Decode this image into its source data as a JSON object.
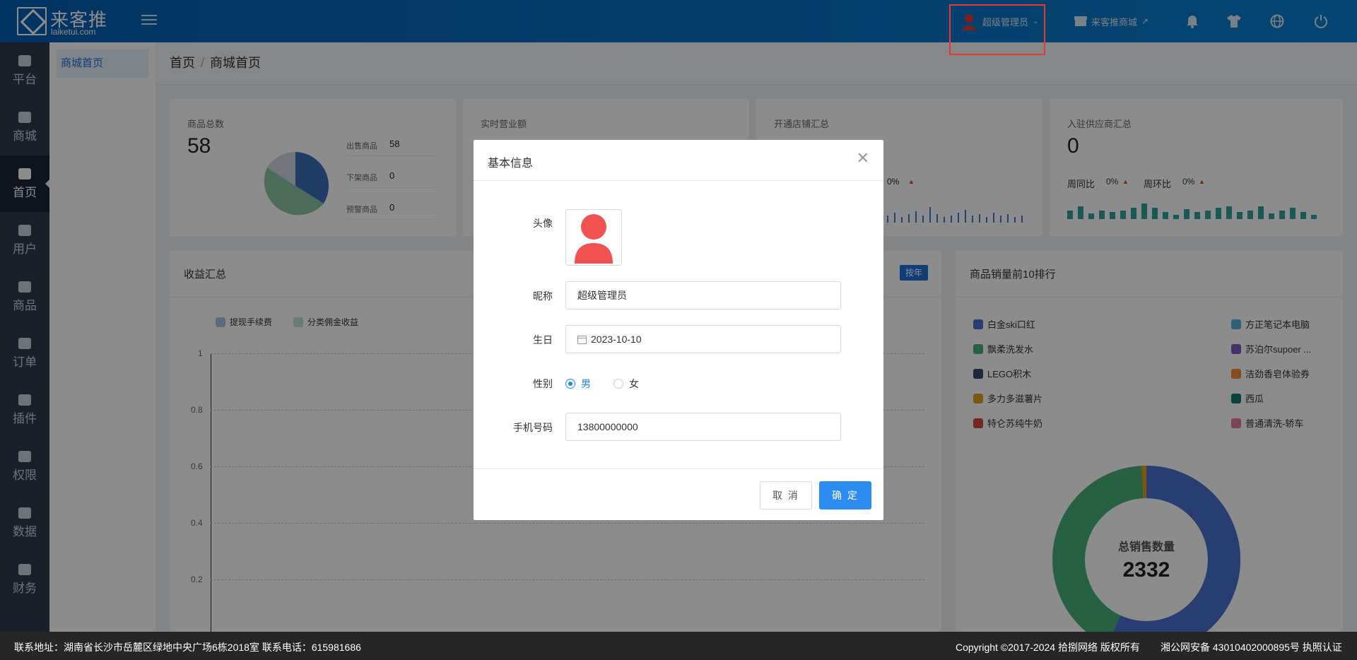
{
  "header": {
    "logo_cn": "来客推",
    "logo_en": "laiketui.com",
    "user_name": "超级管理员",
    "store_link": "来客推商城"
  },
  "sidebar": {
    "items": [
      {
        "label": "平台",
        "icon": "platform-icon"
      },
      {
        "label": "商城",
        "icon": "mall-icon"
      },
      {
        "label": "首页",
        "icon": "home-icon"
      },
      {
        "label": "用户",
        "icon": "user-icon"
      },
      {
        "label": "商品",
        "icon": "goods-icon"
      },
      {
        "label": "订单",
        "icon": "order-icon"
      },
      {
        "label": "插件",
        "icon": "plugin-icon"
      },
      {
        "label": "权限",
        "icon": "shield-icon"
      },
      {
        "label": "数据",
        "icon": "pie-icon"
      },
      {
        "label": "财务",
        "icon": "wallet-icon"
      }
    ]
  },
  "subnav": {
    "item": "商城首页"
  },
  "breadcrumb": {
    "home": "首页",
    "current": "商城首页"
  },
  "cards": {
    "goods": {
      "title": "商品总数",
      "total": "58",
      "rows": [
        {
          "label": "出售商品",
          "value": "58"
        },
        {
          "label": "下架商品",
          "value": "0"
        },
        {
          "label": "预警商品",
          "value": "0"
        }
      ]
    },
    "sales": {
      "title": "实时营业额"
    },
    "stores": {
      "title": "开通店铺汇总",
      "pct": "0%"
    },
    "suppliers": {
      "title": "入驻供应商汇总",
      "total": "0",
      "week_label": "周同比",
      "week_val": "0%",
      "ring_label": "周环比",
      "ring_val": "0%"
    }
  },
  "revenue": {
    "title": "收益汇总",
    "by_year": "按年",
    "legend": [
      "提现手续费",
      "分类佣金收益"
    ],
    "ticks": [
      "1",
      "0.8",
      "0.6",
      "0.4",
      "0.2"
    ]
  },
  "ranking": {
    "title": "商品销量前10排行",
    "center_label": "总销售数量",
    "center_value": "2332",
    "legend": [
      {
        "name": "白金ski口红",
        "color": "#4a6fd0"
      },
      {
        "name": "方正笔记本电脑",
        "color": "#5ab0e0"
      },
      {
        "name": "飘柔洗发水",
        "color": "#4ab07a"
      },
      {
        "name": "苏泊尔supoer ...",
        "color": "#7a5ac0"
      },
      {
        "name": "LEGO积木",
        "color": "#3a4a6a"
      },
      {
        "name": "洁劲香皂体验券",
        "color": "#f08a3a"
      },
      {
        "name": "多力多滋薯片",
        "color": "#e0a020"
      },
      {
        "name": "西瓜",
        "color": "#1a7a6a"
      },
      {
        "name": "特仑苏纯牛奶",
        "color": "#d04a3a"
      },
      {
        "name": "普通清洗-轿车",
        "color": "#e07aa0"
      }
    ]
  },
  "modal": {
    "title": "基本信息",
    "avatar_label": "头像",
    "nickname_label": "昵称",
    "nickname": "超级管理员",
    "birthday_label": "生日",
    "birthday": "2023-10-10",
    "gender_label": "性别",
    "male": "男",
    "female": "女",
    "phone_label": "手机号码",
    "phone": "13800000000",
    "cancel": "取 消",
    "confirm": "确 定"
  },
  "footer": {
    "address": "联系地址：湖南省长沙市岳麓区绿地中央广场6栋2018室 联系电话：615981686",
    "copyright": "Copyright ©2017-2024 拾捌网络 版权所有",
    "icp": "湘公网安备 43010402000895号 执照认证"
  }
}
